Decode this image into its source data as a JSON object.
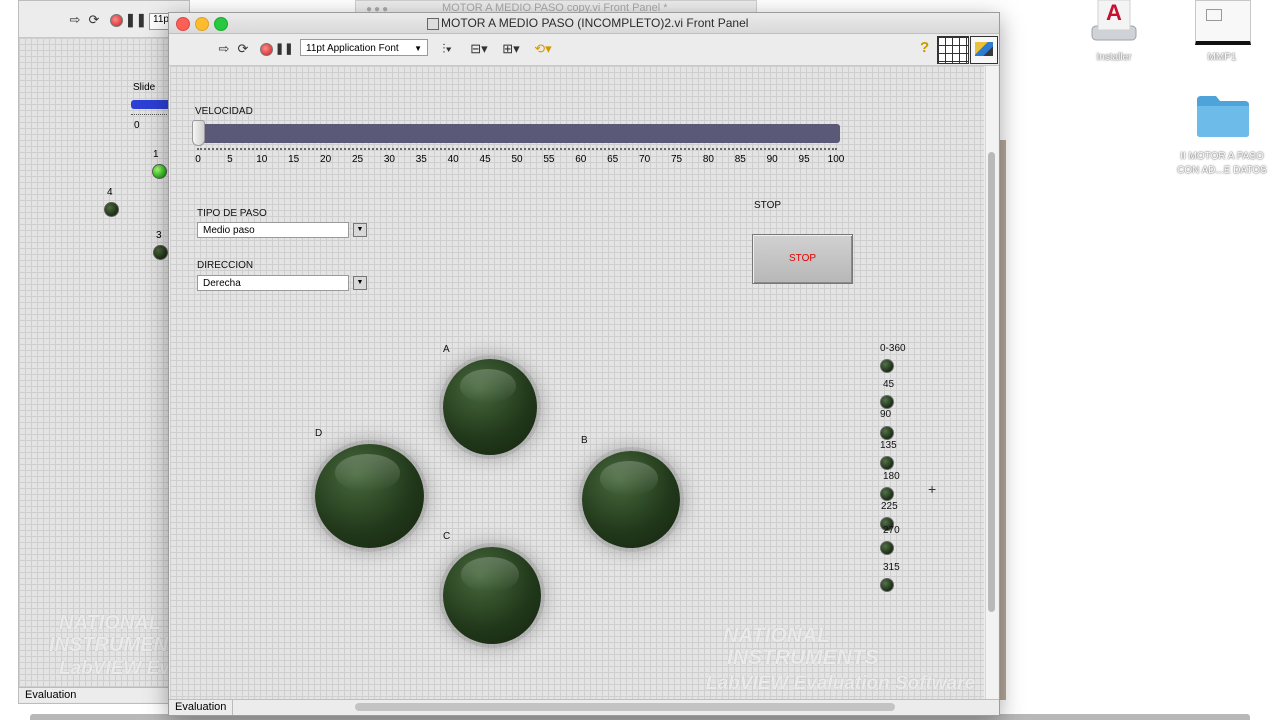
{
  "desktop": {
    "icons": [
      {
        "label": "Installer",
        "icon": "acrobat-installer-icon"
      },
      {
        "label": "MMP1",
        "icon": "document-icon"
      },
      {
        "label": "II MOTOR A PASO CON AD...E DATOS",
        "icon": "folder-icon"
      }
    ]
  },
  "top_window": {
    "title": "MOTOR A MEDIO PASO copy.vi Front Panel *"
  },
  "back_window": {
    "toolbar_font_fragment": "11p",
    "slide_label": "Slide",
    "slide_zero": "0",
    "leds": [
      {
        "label": "1",
        "state": "on"
      },
      {
        "label": "4",
        "state": "off"
      },
      {
        "label": "3",
        "state": "off"
      }
    ],
    "watermark": [
      "NATIONAL",
      "INSTRUMENTS",
      "LabVIEW Evaluation Software"
    ],
    "status": "Evaluation"
  },
  "main_window": {
    "title": "MOTOR A MEDIO PASO (INCOMPLETO)2.vi Front Panel",
    "toolbar": {
      "font_select": "11pt Application Font",
      "help": "?"
    },
    "status": "Evaluation",
    "watermark": [
      "NATIONAL",
      "INSTRUMENTS",
      "LabVIEW Evaluation Software"
    ]
  },
  "velocidad": {
    "label": "VELOCIDAD",
    "min": 0,
    "max": 100,
    "value": 0,
    "ticks": [
      "0",
      "5",
      "10",
      "15",
      "20",
      "25",
      "30",
      "35",
      "40",
      "45",
      "50",
      "55",
      "60",
      "65",
      "70",
      "75",
      "80",
      "85",
      "90",
      "95",
      "100"
    ],
    "track_color": "#5a5977"
  },
  "tipo_de_paso": {
    "label": "TIPO DE PASO",
    "value": "Medio paso"
  },
  "direccion": {
    "label": "DIRECCION",
    "value": "Derecha"
  },
  "stop": {
    "label": "STOP",
    "button_text": "STOP",
    "text_color": "#e00000"
  },
  "coils": [
    {
      "name": "A",
      "state": "off"
    },
    {
      "name": "B",
      "state": "off"
    },
    {
      "name": "C",
      "state": "off"
    },
    {
      "name": "D",
      "state": "off"
    }
  ],
  "angles": [
    {
      "label": "0-360",
      "state": "off"
    },
    {
      "label": "45",
      "state": "off"
    },
    {
      "label": "90",
      "state": "off"
    },
    {
      "label": "135",
      "state": "off"
    },
    {
      "label": "180",
      "state": "off"
    },
    {
      "label": "225",
      "state": "off"
    },
    {
      "label": "270",
      "state": "off"
    },
    {
      "label": "315",
      "state": "off"
    }
  ],
  "led_color_off": "#21381a",
  "led_color_on": "#2fbb1c"
}
